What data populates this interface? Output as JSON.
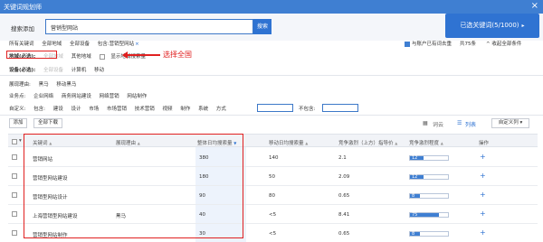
{
  "window": {
    "title": "关键词规划师",
    "close": "×"
  },
  "search": {
    "label": "搜索添加",
    "value": "营销型网站",
    "button": "搜索"
  },
  "selected": {
    "label": "已选关键词(5/1000)",
    "arrow": "▸"
  },
  "filter_tags": {
    "all_keywords": "所有关键词",
    "all_regions": "全部地域",
    "all_devices": "全部设备",
    "contains_label": "包含:营销型网站",
    "contains_close": "×"
  },
  "options": {
    "exclude_label": "与账户已有词去重",
    "total": "共75条",
    "collapse": "^ 收起全部条件"
  },
  "region_row": {
    "label": "地域(必选):",
    "all_regions": "全部地域",
    "other_regions": "其他地域",
    "show_by_region": "显示地域搜索量"
  },
  "device_row": {
    "label": "设备(必选):",
    "all_devices": "全部设备",
    "pc": "计算机",
    "mobile": "移动"
  },
  "annotation": {
    "text": "选择全国"
  },
  "recommend_row": {
    "label": "展现理由:",
    "items": [
      "黑马",
      "移动黑马"
    ]
  },
  "business_row": {
    "label": "业务点:",
    "items": [
      "企业网络",
      "商务网站建设",
      "网络营销",
      "网站制作"
    ]
  },
  "custom_row": {
    "label": "自定义:",
    "contains": "包含:",
    "items": [
      "建设",
      "设计",
      "市场",
      "市场营销",
      "技术营销",
      "视频",
      "制作",
      "系统",
      "方式"
    ],
    "exclude": "不包含:"
  },
  "toolbar": {
    "add": "添加",
    "download_all": "全部下载",
    "chart_view": "词云",
    "list_view": "列表",
    "custom_columns": "自定义列"
  },
  "table": {
    "headers": [
      "关键词",
      "展现理由",
      "整体日均搜索量",
      "移动日均搜索量",
      "竞争激烈（上方）指导价",
      "竞争激烈程度",
      "操作"
    ],
    "rows": [
      {
        "keyword": "营销网站",
        "reason": "",
        "daily": "380",
        "mobile": "140",
        "price": "2.1",
        "competition": "12",
        "fill": 0.35
      },
      {
        "keyword": "营销型网站建设",
        "reason": "",
        "daily": "180",
        "mobile": "50",
        "price": "2.09",
        "competition": "12",
        "fill": 0.35
      },
      {
        "keyword": "营销型网站设计",
        "reason": "",
        "daily": "90",
        "mobile": "80",
        "price": "0.65",
        "competition": "8",
        "fill": 0.25
      },
      {
        "keyword": "上海营销型网站建设",
        "reason": "黑马",
        "daily": "40",
        "mobile": "<5",
        "price": "8.41",
        "competition": "75",
        "fill": 0.75
      },
      {
        "keyword": "营销型网站制作",
        "reason": "",
        "daily": "30",
        "mobile": "<5",
        "price": "0.65",
        "competition": "8",
        "fill": 0.25
      }
    ],
    "action": "+"
  },
  "colors": {
    "brand": "#3f7fd2",
    "annotation": "#e02020"
  }
}
